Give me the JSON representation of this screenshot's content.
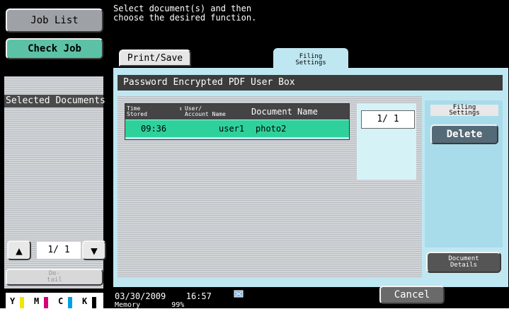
{
  "left": {
    "job_list": "Job List",
    "check_job": "Check Job",
    "selected_documents": "Selected Documents",
    "page": "1/ 1",
    "detail": "De-\ntail",
    "toner": [
      {
        "letter": "Y",
        "color": "#f2e600"
      },
      {
        "letter": "M",
        "color": "#d4007a"
      },
      {
        "letter": "C",
        "color": "#00a0e0"
      },
      {
        "letter": "K",
        "color": "#000000"
      }
    ]
  },
  "top_message": "Select document(s) and then\nchoose the desired function.",
  "tabs": {
    "print_save": "Print/Save",
    "filing_settings": "Filing\nSettings"
  },
  "box_title": "Password Encrypted PDF User Box",
  "table": {
    "headers": {
      "time_stored": "Time\nStored",
      "user_account": "User/\nAccount Name",
      "document_name": "Document Name"
    },
    "rows": [
      {
        "time": "09:36",
        "user": "user1",
        "document": "photo2"
      }
    ]
  },
  "page_indicator": "1/  1",
  "right_panel": {
    "label": "Filing\nSettings",
    "delete": "Delete",
    "document_details": "Document\nDetails"
  },
  "bottom": {
    "date": "03/30/2009",
    "time": "16:57",
    "memory_label": "Memory",
    "memory_value": "99%",
    "cancel": "Cancel"
  },
  "colors": {
    "accent_green": "#2fd19b",
    "panel_blue": "#bfe7f2"
  }
}
